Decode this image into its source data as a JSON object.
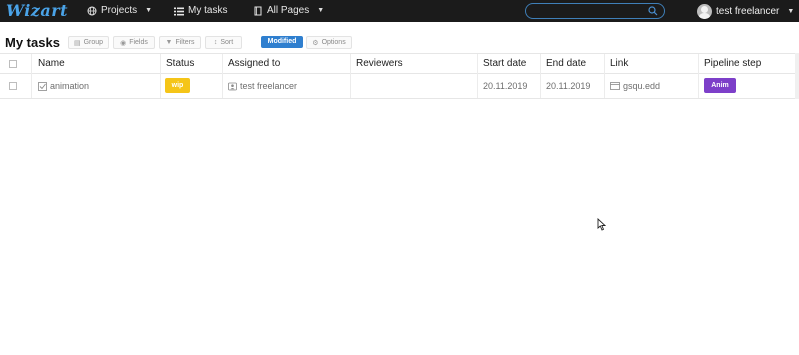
{
  "app": {
    "logo_text": "Wizart",
    "accent": "#4aa3e8"
  },
  "nav": {
    "projects": "Projects",
    "my_tasks": "My tasks",
    "all_pages": "All Pages"
  },
  "search": {
    "placeholder": "",
    "value": ""
  },
  "user": {
    "name": "test freelancer"
  },
  "page": {
    "title": "My tasks"
  },
  "toolbar": {
    "group": "Group",
    "fields": "Fields",
    "filters": "Filters",
    "sort": "Sort",
    "modified": "Modified",
    "options": "Options"
  },
  "table": {
    "columns": [
      "Name",
      "Status",
      "Assigned to",
      "Reviewers",
      "Start date",
      "End date",
      "Link",
      "Pipeline step"
    ],
    "rows": [
      {
        "name": "animation",
        "status": "wip",
        "status_color": "#f5c518",
        "assigned_to": "test freelancer",
        "reviewers": "",
        "start_date": "20.11.2019",
        "end_date": "20.11.2019",
        "link": "gsqu.edd",
        "pipeline_step": "Anim",
        "pipeline_color": "#7d3fc9"
      }
    ]
  }
}
